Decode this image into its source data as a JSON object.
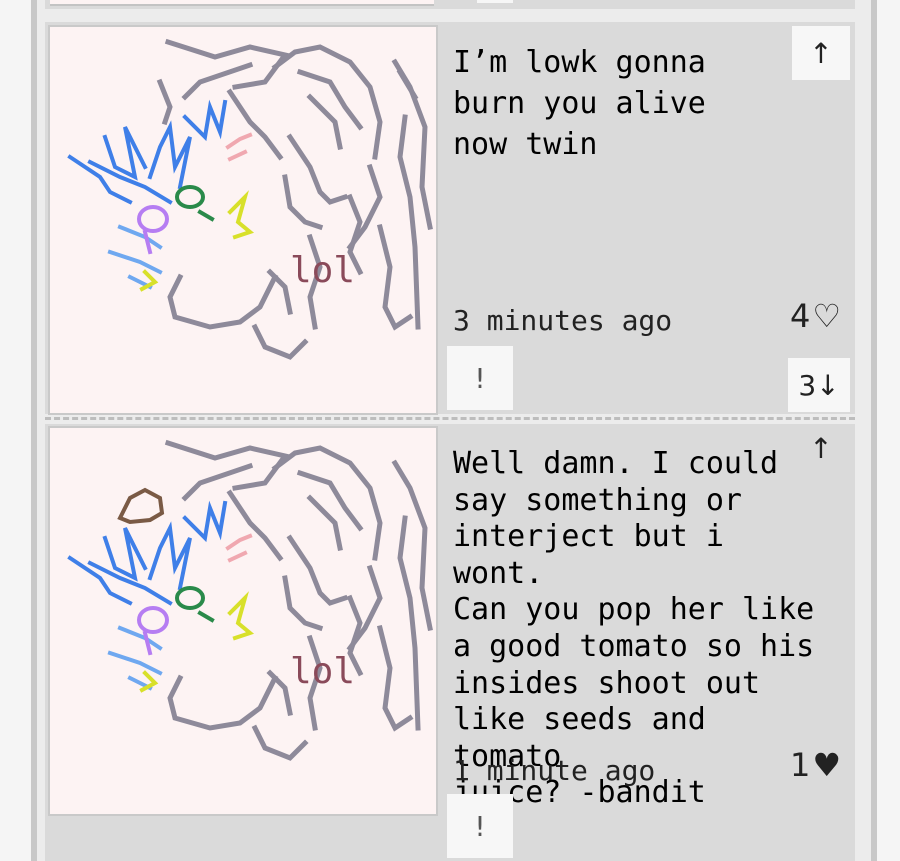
{
  "posts": [
    {
      "caption": "I’m lowk gonna\nburn you alive\nnow twin",
      "drawing_text": "lol",
      "time": "3 minutes ago",
      "likes": "4",
      "like_icon": "heart-outline-icon",
      "upvote": "↑",
      "report": "!",
      "replies": "3↓"
    },
    {
      "caption": "Well damn. I could\nsay something or\ninterject but i wont.\nCan you pop her like\na good tomato so his\ninsides shoot out\nlike seeds and tomato\njuice? -bandit",
      "drawing_text": "lol",
      "time": "1 minute ago",
      "likes": "1",
      "like_icon": "heart-filled-icon",
      "upvote": "↑",
      "report": "!"
    }
  ],
  "colors": {
    "panel": "#dadada",
    "canvas": "#fdf3f3",
    "button": "#f7f7f7",
    "line": "#8e8a9a",
    "blue": "#3f7fe8",
    "purple": "#b67df2",
    "green": "#2a8a4a",
    "yellow": "#d8e02a",
    "blush": "#f0a8b0",
    "lol": "#8a4a5a"
  }
}
